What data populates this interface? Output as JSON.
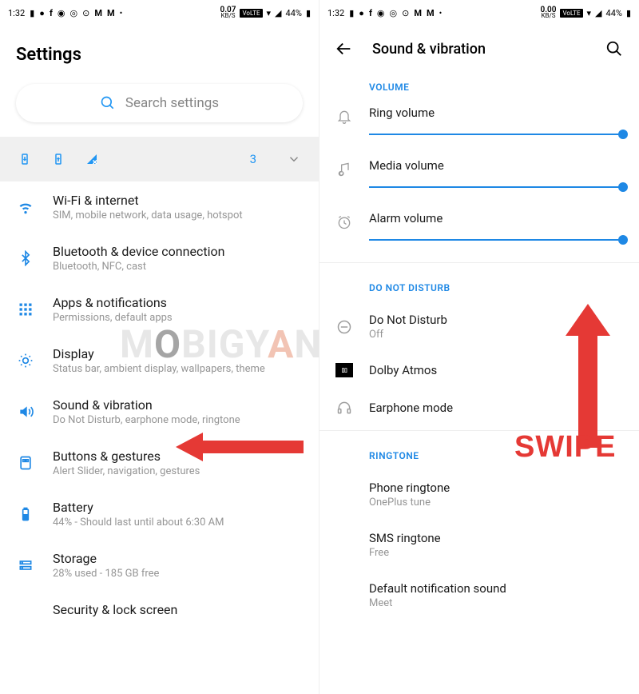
{
  "statusbar": {
    "time": "1:32",
    "kbs_left": "0.07",
    "kbs_unit": "KB/S",
    "kbs_right": "0.00",
    "volte": "VoLTE",
    "battery": "44%"
  },
  "left": {
    "title": "Settings",
    "search_placeholder": "Search settings",
    "suggest_count": "3",
    "items": [
      {
        "title": "Wi-Fi & internet",
        "sub": "SIM, mobile network, data usage, hotspot"
      },
      {
        "title": "Bluetooth & device connection",
        "sub": "Bluetooth, NFC, cast"
      },
      {
        "title": "Apps & notifications",
        "sub": "Permissions, default apps"
      },
      {
        "title": "Display",
        "sub": "Status bar, ambient display, wallpapers, theme"
      },
      {
        "title": "Sound & vibration",
        "sub": "Do Not Disturb, earphone mode, ringtone"
      },
      {
        "title": "Buttons & gestures",
        "sub": "Alert Slider, navigation, gestures"
      },
      {
        "title": "Battery",
        "sub": "44% - Should last until about 6:30 AM"
      },
      {
        "title": "Storage",
        "sub": "28% used - 185 GB free"
      },
      {
        "title": "Security & lock screen",
        "sub": ""
      }
    ]
  },
  "right": {
    "title": "Sound & vibration",
    "sections": {
      "volume": "VOLUME",
      "dnd": "DO NOT DISTURB",
      "ringtone": "RINGTONE"
    },
    "volumes": [
      {
        "label": "Ring volume"
      },
      {
        "label": "Media volume"
      },
      {
        "label": "Alarm volume"
      }
    ],
    "dnd_item": {
      "title": "Do Not Disturb",
      "sub": "Off"
    },
    "dolby": "Dolby Atmos",
    "earphone": "Earphone mode",
    "ringtones": [
      {
        "title": "Phone ringtone",
        "sub": "OnePlus tune"
      },
      {
        "title": "SMS ringtone",
        "sub": "Free"
      },
      {
        "title": "Default notification sound",
        "sub": "Meet"
      }
    ]
  },
  "annotation": {
    "swipe": "SWIPE"
  },
  "watermark": {
    "m": "M",
    "o": "O",
    "big": "BIGY",
    "a": "A",
    "n": "N"
  }
}
